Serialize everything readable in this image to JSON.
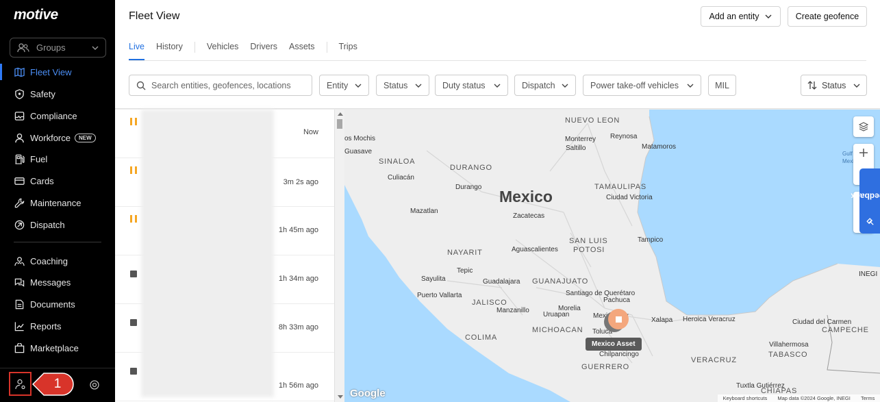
{
  "sidebar": {
    "logo": "motive",
    "groups_label": "Groups",
    "items": [
      {
        "label": "Fleet View",
        "icon": "map-icon"
      },
      {
        "label": "Safety",
        "icon": "shield-icon"
      },
      {
        "label": "Compliance",
        "icon": "compliance-icon"
      },
      {
        "label": "Workforce",
        "icon": "person-icon",
        "badge": "NEW"
      },
      {
        "label": "Fuel",
        "icon": "fuel-icon"
      },
      {
        "label": "Cards",
        "icon": "card-icon"
      },
      {
        "label": "Maintenance",
        "icon": "wrench-icon"
      },
      {
        "label": "Dispatch",
        "icon": "dispatch-icon"
      },
      {
        "label": "Coaching",
        "icon": "coaching-icon"
      },
      {
        "label": "Messages",
        "icon": "messages-icon"
      },
      {
        "label": "Documents",
        "icon": "document-icon"
      },
      {
        "label": "Reports",
        "icon": "reports-icon"
      },
      {
        "label": "Marketplace",
        "icon": "marketplace-icon"
      }
    ],
    "callout_number": "1"
  },
  "header": {
    "title": "Fleet View",
    "add_entity_label": "Add an entity",
    "create_geofence_label": "Create geofence",
    "tabs": [
      "Live",
      "History",
      "Vehicles",
      "Drivers",
      "Assets",
      "Trips"
    ],
    "active_tab": "Live"
  },
  "filters": {
    "search_placeholder": "Search entities, geofences, locations",
    "entity": "Entity",
    "status": "Status",
    "duty_status": "Duty status",
    "dispatch": "Dispatch",
    "pto": "Power take-off vehicles",
    "mil": "MIL",
    "sort_label": "Status"
  },
  "list": {
    "rows": [
      {
        "indicator": "paused",
        "time": "Now"
      },
      {
        "indicator": "paused",
        "time": "3m 2s ago"
      },
      {
        "indicator": "paused",
        "time": "1h 45m ago"
      },
      {
        "indicator": "stopped",
        "time": "1h 34m ago"
      },
      {
        "indicator": "stopped",
        "time": "8h 33m ago"
      },
      {
        "indicator": "stopped",
        "time": "1h 56m ago"
      }
    ]
  },
  "map": {
    "country": "Mexico",
    "states": [
      "NUEVO LEON",
      "SINALOA",
      "DURANGO",
      "TAMAULIPAS",
      "SAN LUIS",
      "POTOSI",
      "NAYARIT",
      "GUANAJUATO",
      "JALISCO",
      "MICHOACAN",
      "COLIMA",
      "GUERRERO",
      "CAMPECHE",
      "TABASCO",
      "CHIAPAS",
      "VERACRUZ"
    ],
    "cities": [
      "os Mochis",
      "Guasave",
      "Culiacán",
      "Monterrey",
      "Saltillo",
      "Reynosa",
      "Matamoros",
      "Durango",
      "Mazatlan",
      "Tampico",
      "Aguascalientes",
      "Tepic",
      "Guadalajara",
      "Sayulita",
      "Puerto Vallarta",
      "Santiago de Querétaro",
      "Pachuca",
      "Mexico City",
      "Toluca",
      "Xalapa",
      "Heroica Veracruz",
      "Ciudad del Carmen",
      "Villahermosa",
      "Tuxtla Gutiérrez",
      "Manzanillo",
      "Uruapan",
      "Ciudad Victoria",
      "Zacatecas",
      "Morelia",
      "Chilpancingo"
    ],
    "seas": [
      "Gulf of",
      "Mexi"
    ],
    "asset_label": "Mexico Asset",
    "feedback_label": "Feedback",
    "google_label": "Google",
    "attribution": [
      "Keyboard shortcuts",
      "Map data ©2024 Google, INEGI",
      "Terms"
    ],
    "partial_text": [
      "INEGI"
    ]
  }
}
